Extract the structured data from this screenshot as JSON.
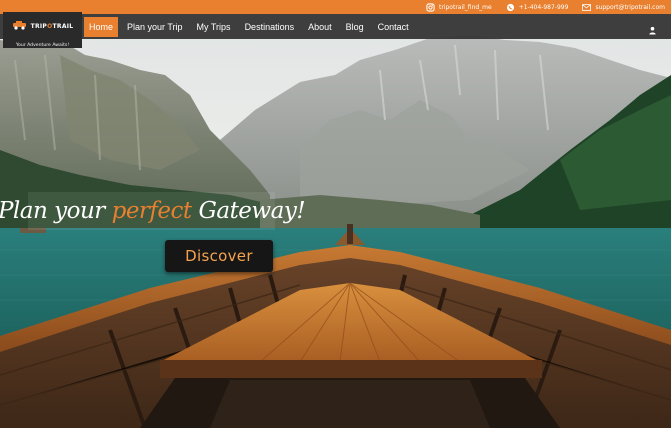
{
  "topbar": {
    "instagram": "tripotrail_find_me",
    "whatsapp": "+1-404-987-999",
    "email": "support@tripotrail.com"
  },
  "logo": {
    "brand_a": "TRIP",
    "brand_b": "O",
    "brand_c": "TRAIL",
    "tagline": "Your Adventure Awaits!"
  },
  "nav": {
    "items": [
      "Home",
      "Plan your Trip",
      "My Trips",
      "Destinations",
      "About",
      "Blog",
      "Contact"
    ],
    "active": "Home"
  },
  "hero": {
    "headline_a": "Plan your ",
    "headline_accent": "perfect",
    "headline_b": " Gateway!",
    "cta_label": "Discover"
  },
  "colors": {
    "accent": "#e8802f",
    "navbar": "#303030",
    "cta_text": "#f6a34f"
  },
  "icons": [
    "instagram-icon",
    "whatsapp-icon",
    "email-icon",
    "user-icon",
    "jeep-logo-icon"
  ]
}
